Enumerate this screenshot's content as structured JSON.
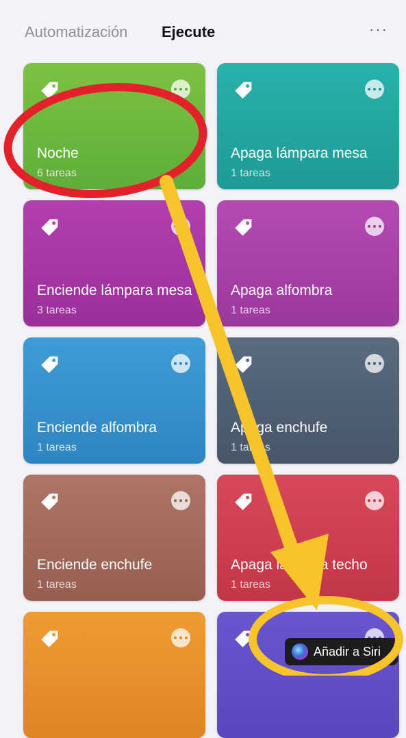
{
  "header": {
    "tabs": [
      {
        "label": "Automatización",
        "active": false
      },
      {
        "label": "Ejecute",
        "active": true
      }
    ],
    "more_label": "···"
  },
  "cards": [
    {
      "title": "Noche",
      "subtitle": "6 tareas",
      "color_top": "#7cc243",
      "color_bottom": "#5fae3a"
    },
    {
      "title": "Apaga lámpara mesa",
      "subtitle": "1 tareas",
      "color_top": "#29b1ac",
      "color_bottom": "#1f9a96"
    },
    {
      "title": "Enciende lámpara mesa",
      "subtitle": "3 tareas",
      "color_top": "#b23fb0",
      "color_bottom": "#9a2f9a"
    },
    {
      "title": "Apaga alfombra",
      "subtitle": "1 tareas",
      "color_top": "#b34bb3",
      "color_bottom": "#9b389d"
    },
    {
      "title": "Enciende alfombra",
      "subtitle": "1 tareas",
      "color_top": "#3f9bd6",
      "color_bottom": "#2e86c0"
    },
    {
      "title": "Apaga enchufe",
      "subtitle": "1 tareas",
      "color_top": "#5a6b80",
      "color_bottom": "#475669"
    },
    {
      "title": "Enciende enchufe",
      "subtitle": "1 tareas",
      "color_top": "#ad7566",
      "color_bottom": "#965f51"
    },
    {
      "title": "Apaga lámpara techo",
      "subtitle": "1 tareas",
      "color_top": "#d9485a",
      "color_bottom": "#c23648"
    },
    {
      "title": "",
      "subtitle": "",
      "color_top": "#ef9b35",
      "color_bottom": "#e08424"
    },
    {
      "title": "",
      "subtitle": "",
      "color_top": "#6a55d1",
      "color_bottom": "#5946bf"
    }
  ],
  "siri_button": {
    "label": "Añadir a Siri",
    "icon": "siri-icon"
  },
  "annotations": {
    "circle_color": "#e4212a",
    "arrow_color": "#f7c52b"
  }
}
